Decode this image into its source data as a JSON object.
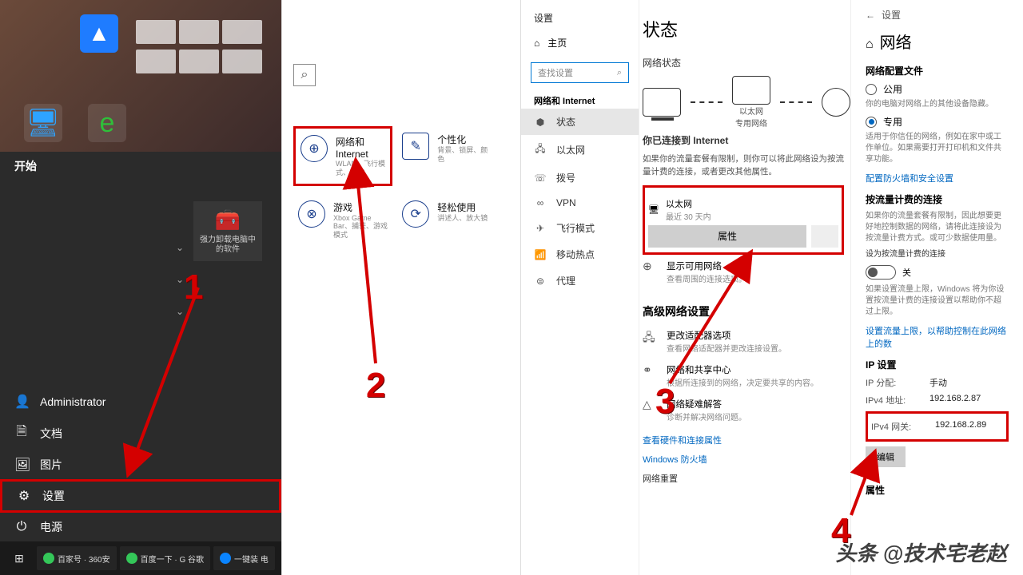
{
  "panel1": {
    "start_label": "开始",
    "pinned": {
      "label": "强力卸载电脑中的软件"
    },
    "items": {
      "admin": "Administrator",
      "docs": "文档",
      "pics": "图片",
      "settings": "设置",
      "power": "电源"
    },
    "taskbar": {
      "a1": "百家号 · 360安",
      "a2": "百度一下 · G 谷歌",
      "a3": "一键装 电"
    }
  },
  "panel2": {
    "cat_network_t": "网络和 Internet",
    "cat_network_s": "WLAN、飞行模式、VPN",
    "cat_personal_t": "个性化",
    "cat_personal_s": "背景、锁屏、颜色",
    "cat_game_t": "游戏",
    "cat_game_s": "Xbox Game Bar、捕获、游戏模式",
    "cat_ease_t": "轻松使用",
    "cat_ease_s": "讲述人、放大镜"
  },
  "panel3": {
    "window": "设置",
    "home": "主页",
    "search_ph": "查找设置",
    "grp": "网络和 Internet",
    "nav": {
      "status": "状态",
      "eth": "以太网",
      "dial": "拨号",
      "vpn": "VPN",
      "air": "飞行模式",
      "hotspot": "移动热点",
      "proxy": "代理"
    },
    "title": "状态",
    "sub1": "网络状态",
    "diag_eth": "以太网",
    "diag_net": "专用网络",
    "connected_t": "你已连接到 Internet",
    "connected_s": "如果你的流量套餐有限制，则你可以将此网络设为按流量计费的连接，或者更改其他属性。",
    "eth_lbl": "以太网",
    "eth_sub": "最近 30 天内",
    "props_btn": "属性",
    "avail_t": "显示可用网络",
    "avail_s": "查看周围的连接选项。",
    "adv_title": "高级网络设置",
    "adapter_t": "更改适配器选项",
    "adapter_s": "查看网络适配器并更改连接设置。",
    "share_t": "网络和共享中心",
    "share_s": "根据所连接到的网络，决定要共享的内容。",
    "trouble_t": "网络疑难解答",
    "trouble_s": "诊断并解决网络问题。",
    "link1": "查看硬件和连接属性",
    "link2": "Windows 防火墙",
    "link3": "网络重置"
  },
  "panel4": {
    "back": "设置",
    "title": "网络",
    "profile_t": "网络配置文件",
    "public": "公用",
    "public_s": "你的电脑对网络上的其他设备隐藏。",
    "private": "专用",
    "private_s": "适用于你信任的网络，例如在家中或工作单位。如果需要打开打印机和文件共享功能。",
    "fw_link": "配置防火墙和安全设置",
    "meter_t": "按流量计费的连接",
    "meter_s": "如果你的流量套餐有限制，因此想要更好地控制数据的网络，请将此连接设为按流量计费方式。或可少数据使用量。",
    "meter_toggle_lbl": "设为按流量计费的连接",
    "toggle_state": "关",
    "meter_note": "如果设置流量上限，Windows 将为你设置按流量计费的连接设置以帮助你不超过上限。",
    "limit_link": "设置流量上限，以帮助控制在此网络上的数",
    "ip_t": "IP 设置",
    "ip_assign_k": "IP 分配:",
    "ip_assign_v": "手动",
    "ipv4_addr_k": "IPv4 地址:",
    "ipv4_addr_v": "192.168.2.87",
    "ipv4_gw_k": "IPv4 网关:",
    "ipv4_gw_v": "192.168.2.89",
    "edit": "编辑",
    "props_t": "属性"
  },
  "anno": {
    "n1": "1",
    "n2": "2",
    "n3": "3",
    "n4": "4"
  },
  "watermark": "头条 @技术宅老赵"
}
